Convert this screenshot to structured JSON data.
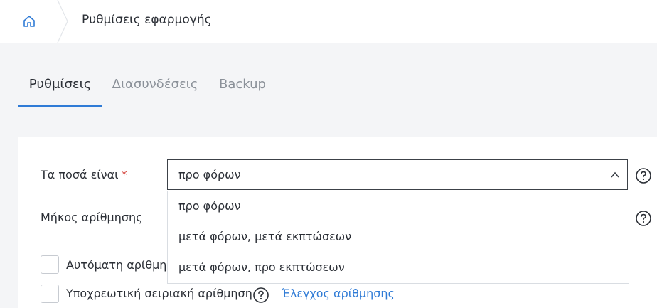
{
  "breadcrumb": {
    "home_icon": "home-icon",
    "title": "Ρυθμίσεις εφαρμογής"
  },
  "tabs": [
    {
      "label": "Ρυθμίσεις",
      "active": true
    },
    {
      "label": "Διασυνδέσεις",
      "active": false
    },
    {
      "label": "Backup",
      "active": false
    }
  ],
  "form": {
    "amounts": {
      "label": "Τα ποσά είναι",
      "required_mark": "*",
      "selected": "προ φόρων",
      "options": [
        "προ φόρων",
        "μετά φόρων, μετά εκπτώσεων",
        "μετά φόρων, προ εκπτώσεων"
      ]
    },
    "numbering_length": {
      "label": "Μήκος αρίθμησης"
    },
    "auto_numbering": {
      "label": "Αυτόματη αρίθμηση"
    },
    "mandatory_serial": {
      "label": "Υποχρεωτική σειριακή αρίθμηση",
      "link": "Έλεγχος αρίθμησης"
    }
  },
  "colors": {
    "accent": "#2f7bd6",
    "required": "#d0342c",
    "background": "#f4f5f7"
  }
}
